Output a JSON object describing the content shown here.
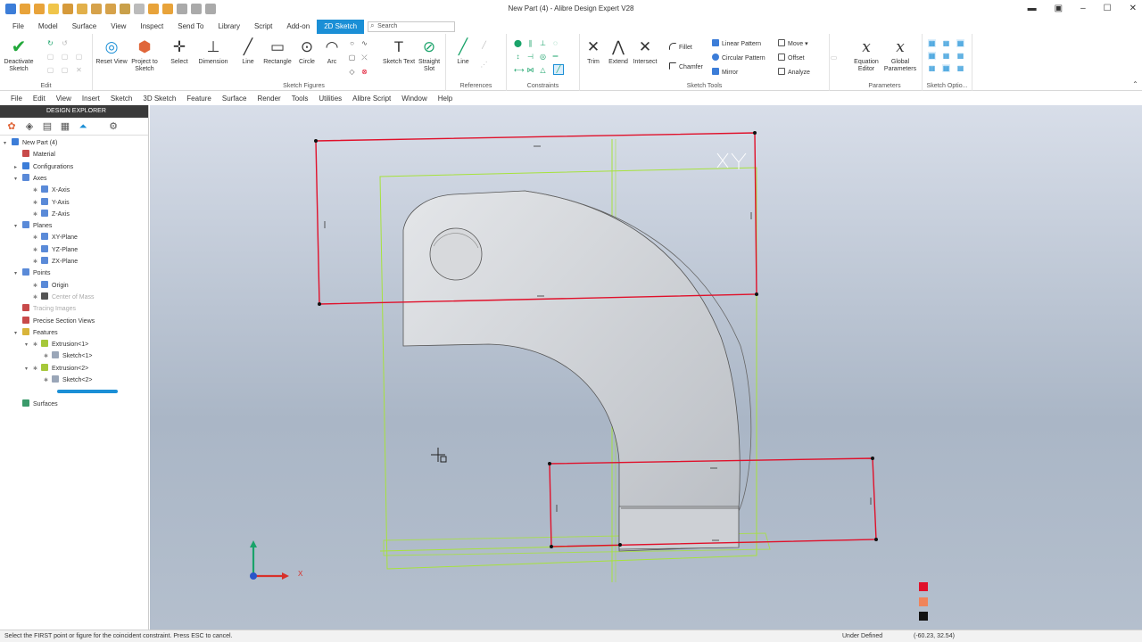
{
  "window": {
    "title": "New Part (4) - Alibre Design Expert V28"
  },
  "ribbon_tabs": [
    "File",
    "Model",
    "Surface",
    "View",
    "Inspect",
    "Send To",
    "Library",
    "Script",
    "Add-on",
    "2D Sketch"
  ],
  "search_placeholder": "Search",
  "ribbon": {
    "edit": {
      "label": "Edit",
      "deactivate": "Deactivate Sketch"
    },
    "view": {
      "reset": "Reset View",
      "project": "Project to Sketch"
    },
    "figures": {
      "label": "Sketch Figures",
      "select": "Select",
      "dimension": "Dimension",
      "line": "Line",
      "rectangle": "Rectangle",
      "circle": "Circle",
      "arc": "Arc",
      "sketch_text": "Sketch Text",
      "straight_slot": "Straight Slot"
    },
    "references": {
      "label": "References",
      "line": "Line"
    },
    "constraints": {
      "label": "Constraints"
    },
    "tools": {
      "label": "Sketch Tools",
      "trim": "Trim",
      "extend": "Extend",
      "intersect": "Intersect",
      "fillet": "Fillet",
      "chamfer": "Chamfer",
      "linear_pattern": "Linear Pattern",
      "circular_pattern": "Circular Pattern",
      "mirror": "Mirror",
      "move": "Move",
      "offset": "Offset",
      "analyze": "Analyze"
    },
    "parameters": {
      "label": "Parameters",
      "equation": "Equation Editor",
      "global": "Global Parameters"
    },
    "options": {
      "label": "Sketch Optio..."
    }
  },
  "menu": [
    "File",
    "Edit",
    "View",
    "Insert",
    "Sketch",
    "3D Sketch",
    "Feature",
    "Surface",
    "Render",
    "Tools",
    "Utilities",
    "Alibre Script",
    "Window",
    "Help"
  ],
  "explorer": {
    "title": "DESIGN EXPLORER",
    "tree": [
      {
        "label": "New Part (4)",
        "depth": 0,
        "icon": "part",
        "twisty": "▾"
      },
      {
        "label": "Material",
        "depth": 1,
        "icon": "material"
      },
      {
        "label": "Configurations",
        "depth": 1,
        "icon": "config",
        "twisty": "▸"
      },
      {
        "label": "Axes",
        "depth": 1,
        "icon": "axes",
        "twisty": "▾"
      },
      {
        "label": "X-Axis",
        "depth": 2,
        "icon": "axis"
      },
      {
        "label": "Y-Axis",
        "depth": 2,
        "icon": "axis"
      },
      {
        "label": "Z-Axis",
        "depth": 2,
        "icon": "axis"
      },
      {
        "label": "Planes",
        "depth": 1,
        "icon": "planes",
        "twisty": "▾"
      },
      {
        "label": "XY-Plane",
        "depth": 2,
        "icon": "plane"
      },
      {
        "label": "YZ-Plane",
        "depth": 2,
        "icon": "plane"
      },
      {
        "label": "ZX-Plane",
        "depth": 2,
        "icon": "plane"
      },
      {
        "label": "Points",
        "depth": 1,
        "icon": "points",
        "twisty": "▾"
      },
      {
        "label": "Origin",
        "depth": 2,
        "icon": "point"
      },
      {
        "label": "Center of Mass",
        "depth": 2,
        "icon": "com",
        "dim": true
      },
      {
        "label": "Tracing Images",
        "depth": 1,
        "icon": "tracing",
        "dim": true
      },
      {
        "label": "Precise Section Views",
        "depth": 1,
        "icon": "section"
      },
      {
        "label": "Features",
        "depth": 1,
        "icon": "features",
        "twisty": "▾"
      },
      {
        "label": "Extrusion<1>",
        "depth": 2,
        "icon": "extrusion",
        "twisty": "▾"
      },
      {
        "label": "Sketch<1>",
        "depth": 3,
        "icon": "sketch"
      },
      {
        "label": "Extrusion<2>",
        "depth": 2,
        "icon": "extrusion",
        "twisty": "▾"
      },
      {
        "label": "Sketch<2>",
        "depth": 3,
        "icon": "sketch"
      },
      {
        "label": "",
        "depth": 2,
        "icon": "newsketch"
      },
      {
        "label": "Surfaces",
        "depth": 1,
        "icon": "surfaces"
      }
    ]
  },
  "viewport": {
    "axis_label": "X"
  },
  "status": {
    "message": "Select the FIRST point or figure for the coincident constraint. Press ESC to cancel.",
    "state": "Under Defined",
    "coords": "(-60.23, 32.54)"
  },
  "colors": {
    "accent": "#1b8fd6",
    "sketch_red": "#e0102a",
    "sketch_green": "#a6e23c",
    "part_gray": "#c9ccd1"
  }
}
